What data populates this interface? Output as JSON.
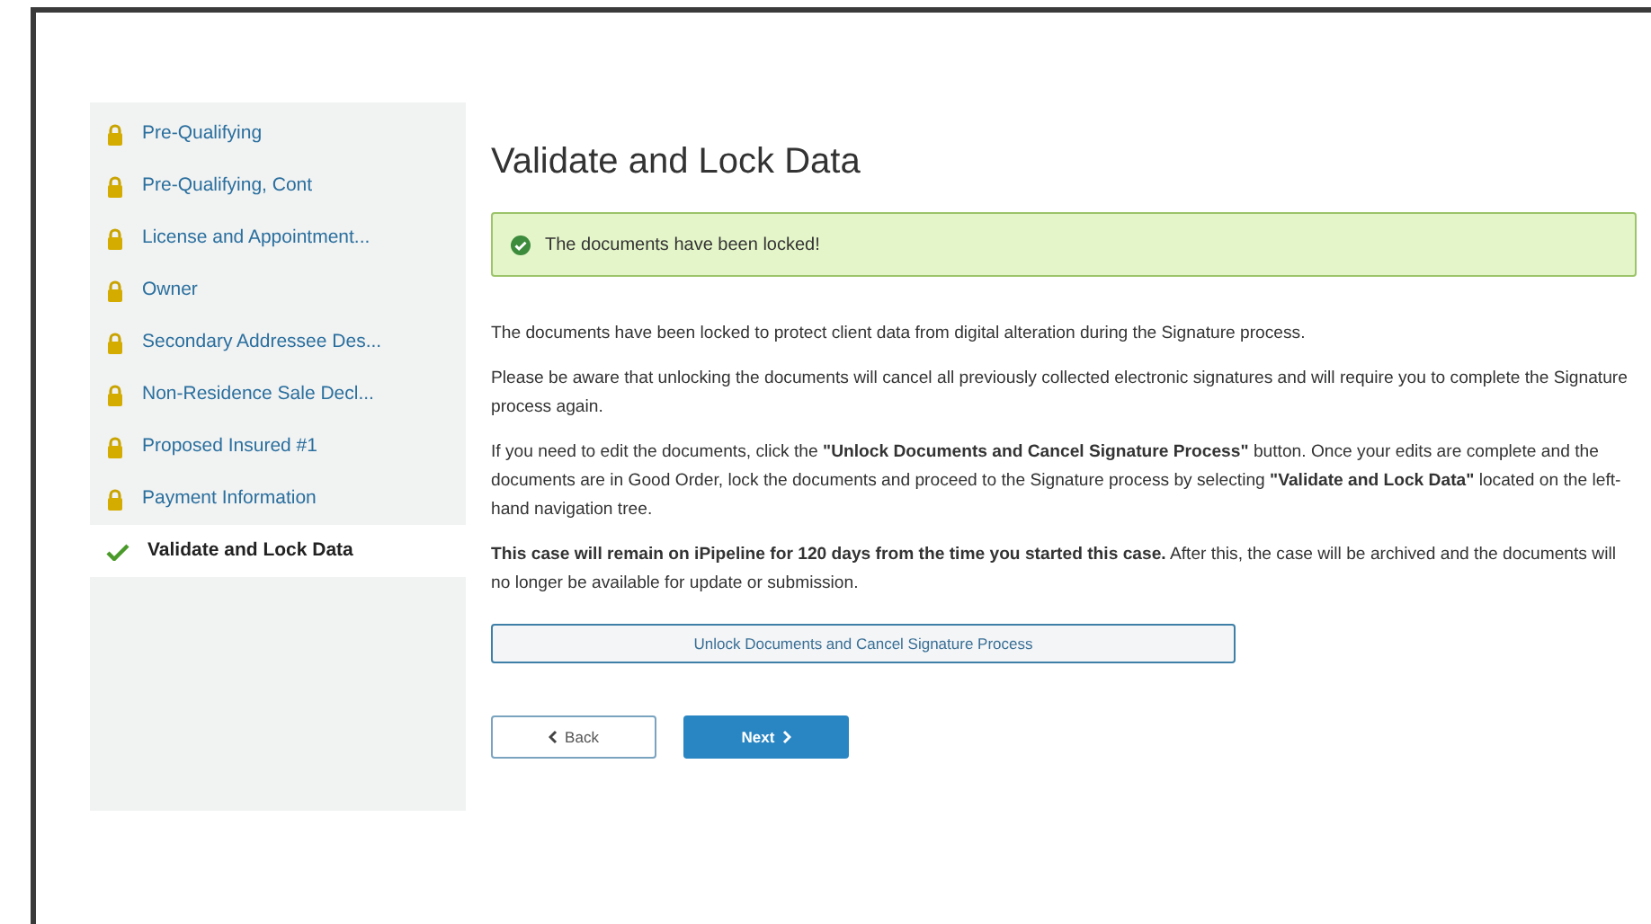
{
  "sidebar": {
    "items": [
      {
        "label": "Pre-Qualifying",
        "kind": "locked",
        "selected": false
      },
      {
        "label": "Pre-Qualifying, Cont",
        "kind": "locked",
        "selected": false
      },
      {
        "label": "License and Appointment...",
        "kind": "locked",
        "selected": false
      },
      {
        "label": "Owner",
        "kind": "locked",
        "selected": false
      },
      {
        "label": "Secondary Addressee Des...",
        "kind": "locked",
        "selected": false
      },
      {
        "label": "Non-Residence Sale Decl...",
        "kind": "locked",
        "selected": false
      },
      {
        "label": "Proposed Insured #1",
        "kind": "locked",
        "selected": false
      },
      {
        "label": "Payment Information",
        "kind": "locked",
        "selected": false
      },
      {
        "label": "Validate and Lock Data",
        "kind": "done",
        "selected": true
      }
    ]
  },
  "main": {
    "title": "Validate and Lock Data",
    "alert": {
      "text": "The documents have been locked!"
    },
    "paragraphs": [
      "The documents have been locked to protect client data from digital alteration during the Signature process.",
      "Please be aware that unlocking the documents will cancel all previously collected electronic signatures and will require you to complete the Signature process again.",
      "If you need to edit the documents, click the **\"Unlock Documents and Cancel Signature Process\"** button. Once your edits are complete and the documents are in Good Order, lock the documents and proceed to the Signature process by selecting **\"Validate and Lock Data\"** located on the left-hand navigation tree.",
      "**This case will remain on iPipeline for 120 days from the time you started this case.** After this, the case will be archived and the documents will no longer be available for update or submission."
    ],
    "unlock_button": "Unlock Documents and Cancel Signature Process",
    "back_button": "Back",
    "next_button": "Next"
  }
}
